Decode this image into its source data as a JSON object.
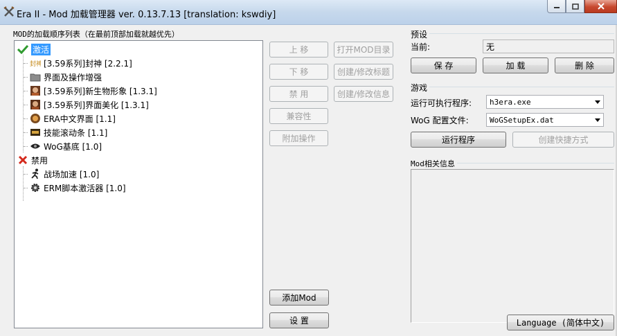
{
  "window": {
    "title": "Era II - Mod 加载管理器 ver. 0.13.7.13 [translation: kswdiy]"
  },
  "mods_panel": {
    "heading": "MOD的加载顺序列表（在最前顶部加载就越优先）",
    "enabled_group": {
      "label": "激活",
      "items": [
        {
          "label": "[3.59系列]封神 [2.2.1]",
          "icon": "fengshen-icon"
        },
        {
          "label": "界面及操作增强",
          "icon": "folder-icon"
        },
        {
          "label": "[3.59系列]新生物形象 [1.3.1]",
          "icon": "portrait-icon"
        },
        {
          "label": "[3.59系列]界面美化 [1.3.1]",
          "icon": "portrait-icon"
        },
        {
          "label": "ERA中文界面 [1.1]",
          "icon": "orb-icon"
        },
        {
          "label": "技能滚动条 [1.1]",
          "icon": "scroll-bar-icon"
        },
        {
          "label": "WoG基底 [1.0]",
          "icon": "eye-icon"
        }
      ]
    },
    "disabled_group": {
      "label": "禁用",
      "items": [
        {
          "label": "战场加速 [1.0]",
          "icon": "running-man-icon"
        },
        {
          "label": "ERM脚本激活器 [1.0]",
          "icon": "gear-icon"
        }
      ]
    }
  },
  "actions": {
    "move_up": "上 移",
    "move_down": "下 移",
    "disable": "禁 用",
    "compatibility": "兼容性",
    "extra_ops": "附加操作",
    "open_mod_dir": "打开MOD目录",
    "edit_title": "创建/修改标题",
    "edit_info": "创建/修改信息",
    "add_mod": "添加Mod",
    "settings": "设 置"
  },
  "preset": {
    "heading": "预设",
    "current_label": "当前:",
    "current_value": "无",
    "save": "保 存",
    "load": "加 载",
    "delete": "删 除"
  },
  "game": {
    "heading": "游戏",
    "exe_label": "运行可执行程序:",
    "exe_value": "h3era.exe",
    "config_label": "WoG 配置文件:",
    "config_value": "WoGSetupEx.dat",
    "run": "运行程序",
    "create_shortcut": "创建快捷方式"
  },
  "mod_info": {
    "heading": "Mod相关信息",
    "text": ""
  },
  "language_button": "Language (简体中文)",
  "colors": {
    "selection": "#3399ff",
    "enabled_check": "#2f9a2f",
    "disabled_cross": "#d42a1d"
  }
}
